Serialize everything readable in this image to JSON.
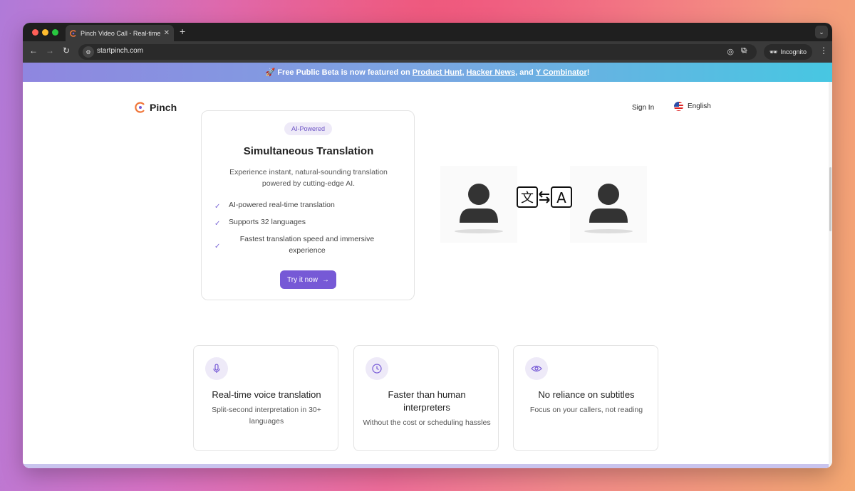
{
  "browser": {
    "tab_title": "Pinch Video Call - Real-time AI",
    "url": "startpinch.com",
    "incognito_label": "Incognito",
    "new_tab": "+",
    "close": "✕"
  },
  "banner": {
    "prefix": "🚀 Free Public Beta is now featured on ",
    "link1": "Product Hunt",
    "sep1": ", ",
    "link2": "Hacker News",
    "sep2": ", and ",
    "link3": "Y Combinator",
    "suffix": "!"
  },
  "header": {
    "brand": "Pinch",
    "sign_in": "Sign In",
    "language": "English"
  },
  "hero_card": {
    "badge": "AI-Powered",
    "title": "Simultaneous Translation",
    "description": "Experience instant, natural-sounding translation powered by cutting-edge AI.",
    "features": [
      "AI-powered real-time translation",
      "Supports 32 languages",
      "Fastest translation speed and immersive experience"
    ],
    "cta": "Try it now"
  },
  "features": [
    {
      "icon": "microphone-icon",
      "title": "Real-time voice translation",
      "text": "Split-second interpretation in 30+ languages"
    },
    {
      "icon": "clock-icon",
      "title": "Faster than human interpreters",
      "text": "Without the cost or scheduling hassles"
    },
    {
      "icon": "eye-icon",
      "title": "No reliance on subtitles",
      "text": "Focus on your callers, not reading"
    }
  ],
  "colors": {
    "accent": "#7659d6",
    "badge_bg": "#eeeaf8"
  }
}
